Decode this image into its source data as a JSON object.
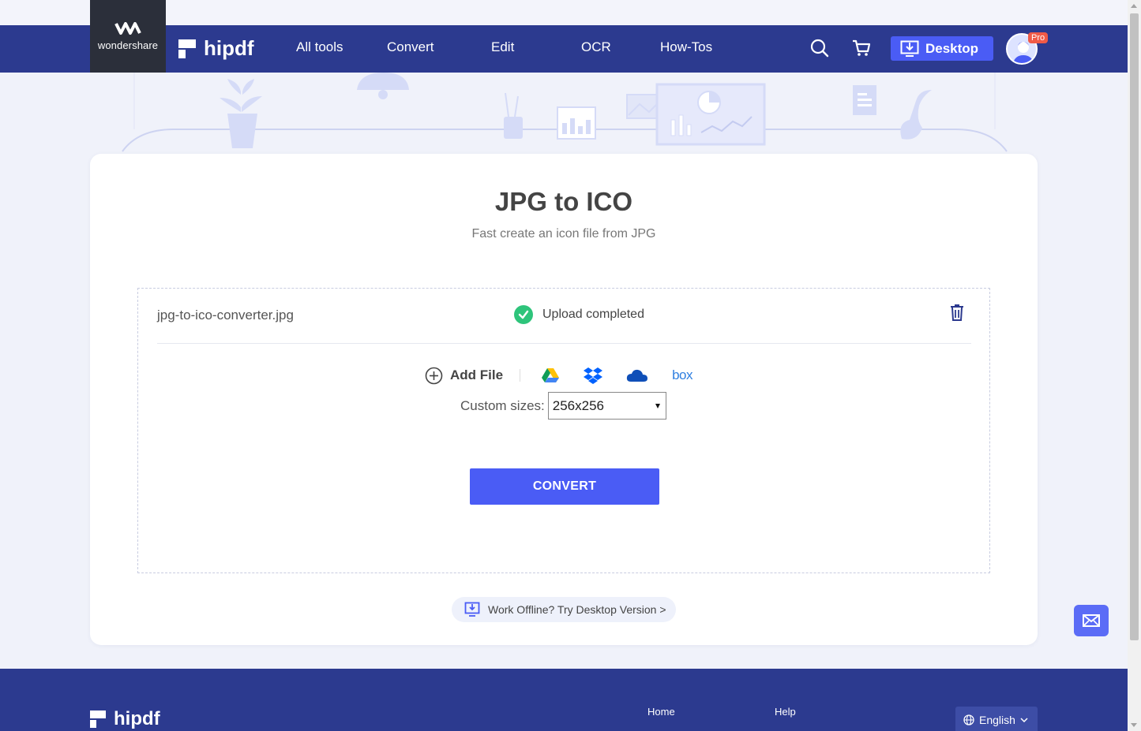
{
  "brand": {
    "company": "wondershare",
    "product": "hipdf",
    "accent_color": "#4a5cf5",
    "nav_color": "#2c3a8f"
  },
  "nav": {
    "links": [
      "All tools",
      "Convert",
      "Edit",
      "OCR",
      "How-Tos"
    ],
    "desktop_label": "Desktop",
    "pro_badge": "Pro",
    "search_icon": "search-icon",
    "cart_icon": "cart-icon"
  },
  "tool": {
    "title": "JPG to ICO",
    "subtitle": "Fast create an icon file from JPG"
  },
  "upload": {
    "file_name": "jpg-to-ico-converter.jpg",
    "status": "Upload completed",
    "status_color": "#2ec47b",
    "add_file_label": "Add File",
    "cloud_sources": [
      "google-drive-icon",
      "dropbox-icon",
      "onedrive-icon",
      "box-icon"
    ],
    "box_label": "box"
  },
  "options": {
    "custom_sizes_label": "Custom sizes:",
    "custom_sizes_value": "256x256"
  },
  "actions": {
    "convert_label": "CONVERT",
    "offline_label": "Work Offline? Try Desktop Version >"
  },
  "footer": {
    "logo": "hipdf",
    "links": [
      "Home",
      "Help"
    ],
    "language": "English"
  }
}
